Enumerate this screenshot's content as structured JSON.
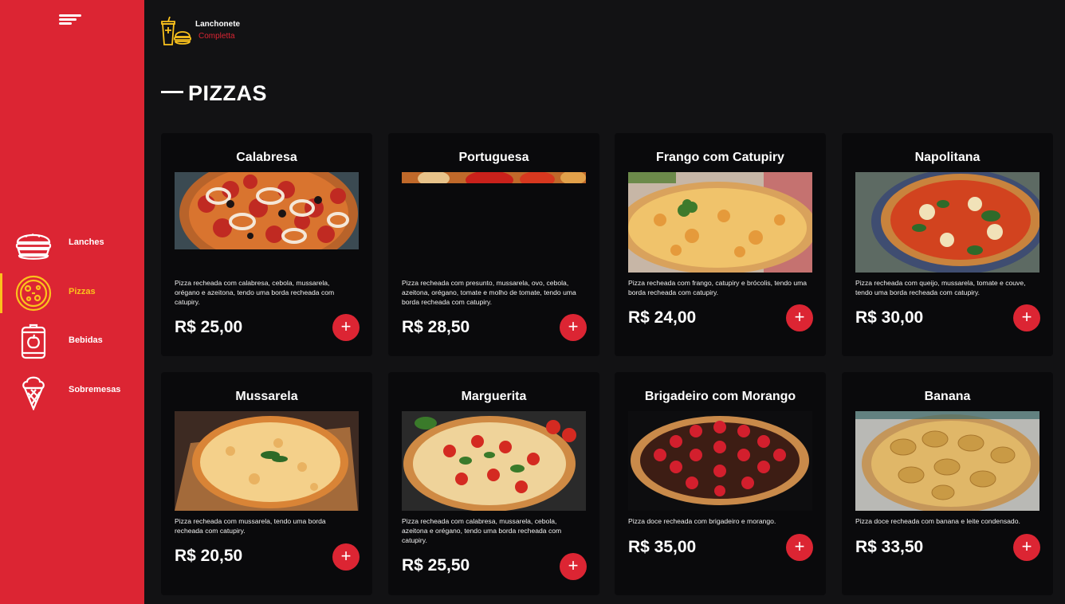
{
  "brand": {
    "line1": "Lanchonete",
    "line2": "Completta"
  },
  "sidebar": {
    "items": [
      {
        "label": "Lanches",
        "icon": "burger-icon",
        "active": false
      },
      {
        "label": "Pizzas",
        "icon": "pizza-icon",
        "active": true
      },
      {
        "label": "Bebidas",
        "icon": "drink-can-icon",
        "active": false
      },
      {
        "label": "Sobremesas",
        "icon": "ice-cream-icon",
        "active": false
      }
    ]
  },
  "section": {
    "title": "PIZZAS"
  },
  "products": [
    {
      "name": "Calabresa",
      "description": "Pizza recheada com calabresa, cebola, mussarela, orégano e azeitona, tendo uma borda recheada com catupiry.",
      "price": "R$ 25,00",
      "add_label": "+"
    },
    {
      "name": "Portuguesa",
      "description": "Pizza recheada com presunto, mussarela, ovo, cebola, azeitona, orégano, tomate e molho de tomate, tendo uma borda recheada com catupiry.",
      "price": "R$ 28,50",
      "add_label": "+"
    },
    {
      "name": "Frango com Catupiry",
      "description": "Pizza recheada com frango, catupiry e brócolis, tendo uma borda recheada com catupiry.",
      "price": "R$ 24,00",
      "add_label": "+"
    },
    {
      "name": "Napolitana",
      "description": "Pizza recheada com queijo, mussarela, tomate e couve, tendo uma borda recheada com catupiry.",
      "price": "R$ 30,00",
      "add_label": "+"
    },
    {
      "name": "Mussarela",
      "description": "Pizza recheada com mussarela, tendo uma borda recheada com catupiry.",
      "price": "R$ 20,50",
      "add_label": "+"
    },
    {
      "name": "Marguerita",
      "description": "Pizza recheada com calabresa, mussarela, cebola, azeitona e orégano, tendo uma borda recheada com catupiry.",
      "price": "R$ 25,50",
      "add_label": "+"
    },
    {
      "name": "Brigadeiro com Morango",
      "description": "Pizza doce recheada com brigadeiro e morango.",
      "price": "R$ 35,00",
      "add_label": "+"
    },
    {
      "name": "Banana",
      "description": "Pizza doce recheada com banana e leite condensado.",
      "price": "R$ 33,50",
      "add_label": "+"
    }
  ],
  "colors": {
    "accent": "#dc2533",
    "active": "#fbc21c",
    "background": "#121214",
    "card": "#0a0a0c"
  }
}
